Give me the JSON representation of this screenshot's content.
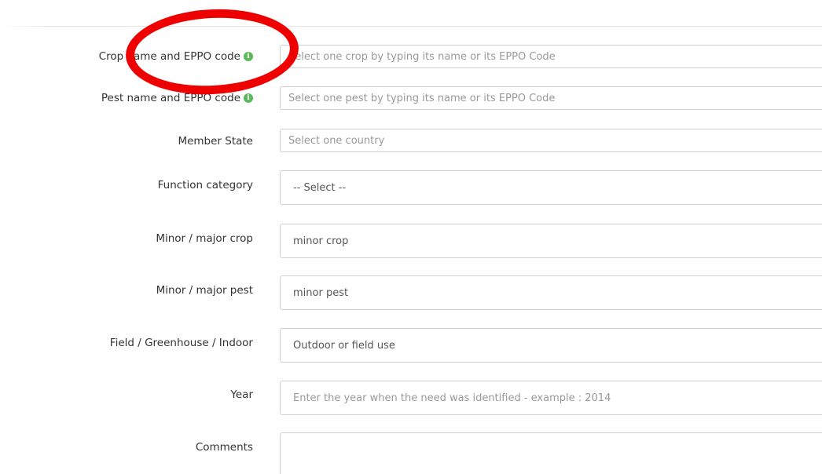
{
  "form": {
    "crop": {
      "label": "Crop name and EPPO code",
      "placeholder": "Select one crop by typing its name or its EPPO Code"
    },
    "pest": {
      "label": "Pest name and EPPO code",
      "placeholder": "Select one pest by typing its name or its EPPO Code"
    },
    "member_state": {
      "label": "Member State",
      "placeholder": "Select one country"
    },
    "function_category": {
      "label": "Function category",
      "value": "-- Select --"
    },
    "minor_major_crop": {
      "label": "Minor / major crop",
      "value": "minor crop"
    },
    "minor_major_pest": {
      "label": "Minor / major pest",
      "value": "minor pest"
    },
    "field_greenhouse_indoor": {
      "label": "Field / Greenhouse / Indoor",
      "value": "Outdoor or field use"
    },
    "year": {
      "label": "Year",
      "placeholder": "Enter the year when the need was identified - example : 2014"
    },
    "comments": {
      "label": "Comments",
      "value": ""
    }
  },
  "icons": {
    "info": "info-icon"
  },
  "colors": {
    "info_icon": "#5cb85c",
    "annotation_circle": "#ee0000"
  }
}
